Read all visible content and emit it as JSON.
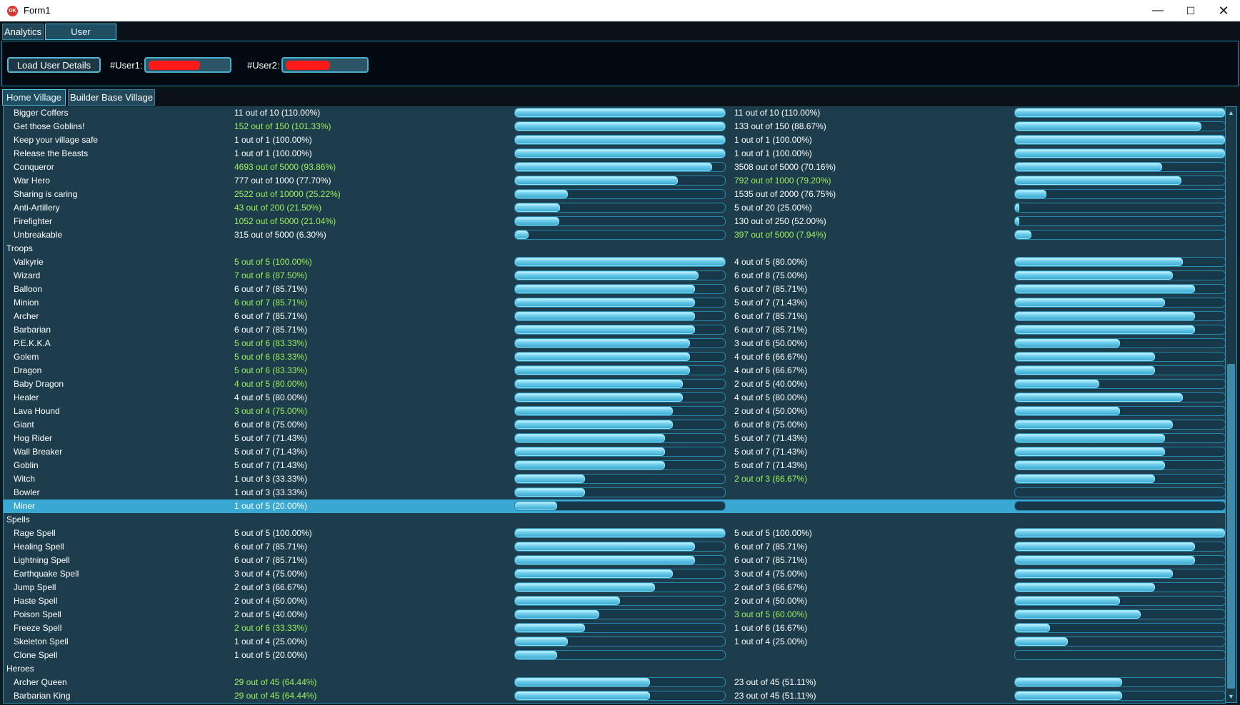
{
  "window": {
    "title": "Form1",
    "app_icon_label": "OK"
  },
  "tabs": [
    {
      "label": "Analytics",
      "active": false
    },
    {
      "label": "User Comparison",
      "active": true
    }
  ],
  "header": {
    "load_button": "Load User Details",
    "user1_label": "#User1:",
    "user2_label": "#User2:"
  },
  "subtabs": [
    {
      "label": "Home Village",
      "active": true
    },
    {
      "label": "Builder Base Village",
      "active": false
    }
  ],
  "colors": {
    "highlight_green": "#9cf05c",
    "selected_row": "#39a9d3",
    "accent": "#4ec8ee"
  },
  "rows": [
    {
      "type": "item",
      "name": "Bigger Coffers",
      "u1": "11 out of 10 (110.00%)",
      "u1_pct": 100,
      "u1_green": false,
      "u2": "11 out of 10 (110.00%)",
      "u2_pct": 100,
      "u2_green": false
    },
    {
      "type": "item",
      "name": "Get those Goblins!",
      "u1": "152 out of 150 (101.33%)",
      "u1_pct": 100,
      "u1_green": true,
      "u2": "133 out of 150 (88.67%)",
      "u2_pct": 88.67,
      "u2_green": false
    },
    {
      "type": "item",
      "name": "Keep your village safe",
      "u1": "1 out of 1 (100.00%)",
      "u1_pct": 100,
      "u1_green": false,
      "u2": "1 out of 1 (100.00%)",
      "u2_pct": 100,
      "u2_green": false
    },
    {
      "type": "item",
      "name": "Release the Beasts",
      "u1": "1 out of 1 (100.00%)",
      "u1_pct": 100,
      "u1_green": false,
      "u2": "1 out of 1 (100.00%)",
      "u2_pct": 100,
      "u2_green": false
    },
    {
      "type": "item",
      "name": "Conqueror",
      "u1": "4693 out of 5000 (93.86%)",
      "u1_pct": 93.86,
      "u1_green": true,
      "u2": "3508 out of 5000 (70.16%)",
      "u2_pct": 70.16,
      "u2_green": false
    },
    {
      "type": "item",
      "name": "War Hero",
      "u1": "777 out of 1000 (77.70%)",
      "u1_pct": 77.7,
      "u1_green": false,
      "u2": "792 out of 1000 (79.20%)",
      "u2_pct": 79.2,
      "u2_green": true
    },
    {
      "type": "item",
      "name": "Sharing is caring",
      "u1": "2522 out of 10000 (25.22%)",
      "u1_pct": 25.22,
      "u1_green": true,
      "u2": "1535 out of 2000 (76.75%)",
      "u2_pct": 15,
      "u2_green": false
    },
    {
      "type": "item",
      "name": "Anti-Artillery",
      "u1": "43 out of 200 (21.50%)",
      "u1_pct": 21.5,
      "u1_green": true,
      "u2": "5 out of 20 (25.00%)",
      "u2_pct": 2,
      "u2_green": false
    },
    {
      "type": "item",
      "name": "Firefighter",
      "u1": "1052 out of 5000 (21.04%)",
      "u1_pct": 21.04,
      "u1_green": true,
      "u2": "130 out of 250 (52.00%)",
      "u2_pct": 2,
      "u2_green": false
    },
    {
      "type": "item",
      "name": "Unbreakable",
      "u1": "315 out of 5000 (6.30%)",
      "u1_pct": 6.3,
      "u1_green": false,
      "u2": "397 out of 5000 (7.94%)",
      "u2_pct": 7.94,
      "u2_green": true
    },
    {
      "type": "group",
      "name": "Troops"
    },
    {
      "type": "item",
      "name": "Valkyrie",
      "u1": "5 out of 5 (100.00%)",
      "u1_pct": 100,
      "u1_green": true,
      "u2": "4 out of 5 (80.00%)",
      "u2_pct": 80,
      "u2_green": false
    },
    {
      "type": "item",
      "name": "Wizard",
      "u1": "7 out of 8 (87.50%)",
      "u1_pct": 87.5,
      "u1_green": true,
      "u2": "6 out of 8 (75.00%)",
      "u2_pct": 75,
      "u2_green": false
    },
    {
      "type": "item",
      "name": "Balloon",
      "u1": "6 out of 7 (85.71%)",
      "u1_pct": 85.71,
      "u1_green": false,
      "u2": "6 out of 7 (85.71%)",
      "u2_pct": 85.71,
      "u2_green": false
    },
    {
      "type": "item",
      "name": "Minion",
      "u1": "6 out of 7 (85.71%)",
      "u1_pct": 85.71,
      "u1_green": true,
      "u2": "5 out of 7 (71.43%)",
      "u2_pct": 71.43,
      "u2_green": false
    },
    {
      "type": "item",
      "name": "Archer",
      "u1": "6 out of 7 (85.71%)",
      "u1_pct": 85.71,
      "u1_green": false,
      "u2": "6 out of 7 (85.71%)",
      "u2_pct": 85.71,
      "u2_green": false
    },
    {
      "type": "item",
      "name": "Barbarian",
      "u1": "6 out of 7 (85.71%)",
      "u1_pct": 85.71,
      "u1_green": false,
      "u2": "6 out of 7 (85.71%)",
      "u2_pct": 85.71,
      "u2_green": false
    },
    {
      "type": "item",
      "name": "P.E.K.K.A",
      "u1": "5 out of 6 (83.33%)",
      "u1_pct": 83.33,
      "u1_green": true,
      "u2": "3 out of 6 (50.00%)",
      "u2_pct": 50,
      "u2_green": false
    },
    {
      "type": "item",
      "name": "Golem",
      "u1": "5 out of 6 (83.33%)",
      "u1_pct": 83.33,
      "u1_green": true,
      "u2": "4 out of 6 (66.67%)",
      "u2_pct": 66.67,
      "u2_green": false
    },
    {
      "type": "item",
      "name": "Dragon",
      "u1": "5 out of 6 (83.33%)",
      "u1_pct": 83.33,
      "u1_green": true,
      "u2": "4 out of 6 (66.67%)",
      "u2_pct": 66.67,
      "u2_green": false
    },
    {
      "type": "item",
      "name": "Baby Dragon",
      "u1": "4 out of 5 (80.00%)",
      "u1_pct": 80,
      "u1_green": true,
      "u2": "2 out of 5 (40.00%)",
      "u2_pct": 40,
      "u2_green": false
    },
    {
      "type": "item",
      "name": "Healer",
      "u1": "4 out of 5 (80.00%)",
      "u1_pct": 80,
      "u1_green": false,
      "u2": "4 out of 5 (80.00%)",
      "u2_pct": 80,
      "u2_green": false
    },
    {
      "type": "item",
      "name": "Lava Hound",
      "u1": "3 out of 4 (75.00%)",
      "u1_pct": 75,
      "u1_green": true,
      "u2": "2 out of 4 (50.00%)",
      "u2_pct": 50,
      "u2_green": false
    },
    {
      "type": "item",
      "name": "Giant",
      "u1": "6 out of 8 (75.00%)",
      "u1_pct": 75,
      "u1_green": false,
      "u2": "6 out of 8 (75.00%)",
      "u2_pct": 75,
      "u2_green": false
    },
    {
      "type": "item",
      "name": "Hog Rider",
      "u1": "5 out of 7 (71.43%)",
      "u1_pct": 71.43,
      "u1_green": false,
      "u2": "5 out of 7 (71.43%)",
      "u2_pct": 71.43,
      "u2_green": false
    },
    {
      "type": "item",
      "name": "Wall Breaker",
      "u1": "5 out of 7 (71.43%)",
      "u1_pct": 71.43,
      "u1_green": false,
      "u2": "5 out of 7 (71.43%)",
      "u2_pct": 71.43,
      "u2_green": false
    },
    {
      "type": "item",
      "name": "Goblin",
      "u1": "5 out of 7 (71.43%)",
      "u1_pct": 71.43,
      "u1_green": false,
      "u2": "5 out of 7 (71.43%)",
      "u2_pct": 71.43,
      "u2_green": false
    },
    {
      "type": "item",
      "name": "Witch",
      "u1": "1 out of 3 (33.33%)",
      "u1_pct": 33.33,
      "u1_green": false,
      "u2": "2 out of 3 (66.67%)",
      "u2_pct": 66.67,
      "u2_green": true
    },
    {
      "type": "item",
      "name": "Bowler",
      "u1": "1 out of 3 (33.33%)",
      "u1_pct": 33.33,
      "u1_green": false,
      "u2": "",
      "u2_pct": 0,
      "u2_green": false
    },
    {
      "type": "item",
      "name": "Miner",
      "u1": "1 out of 5 (20.00%)",
      "u1_pct": 20,
      "u1_green": false,
      "u2": "",
      "u2_pct": 0,
      "u2_green": false,
      "selected": true
    },
    {
      "type": "group",
      "name": "Spells"
    },
    {
      "type": "item",
      "name": "Rage Spell",
      "u1": "5 out of 5 (100.00%)",
      "u1_pct": 100,
      "u1_green": false,
      "u2": "5 out of 5 (100.00%)",
      "u2_pct": 100,
      "u2_green": false
    },
    {
      "type": "item",
      "name": "Healing Spell",
      "u1": "6 out of 7 (85.71%)",
      "u1_pct": 85.71,
      "u1_green": false,
      "u2": "6 out of 7 (85.71%)",
      "u2_pct": 85.71,
      "u2_green": false
    },
    {
      "type": "item",
      "name": "Lightning Spell",
      "u1": "6 out of 7 (85.71%)",
      "u1_pct": 85.71,
      "u1_green": false,
      "u2": "6 out of 7 (85.71%)",
      "u2_pct": 85.71,
      "u2_green": false
    },
    {
      "type": "item",
      "name": "Earthquake Spell",
      "u1": "3 out of 4 (75.00%)",
      "u1_pct": 75,
      "u1_green": false,
      "u2": "3 out of 4 (75.00%)",
      "u2_pct": 75,
      "u2_green": false
    },
    {
      "type": "item",
      "name": "Jump Spell",
      "u1": "2 out of 3 (66.67%)",
      "u1_pct": 66.67,
      "u1_green": false,
      "u2": "2 out of 3 (66.67%)",
      "u2_pct": 66.67,
      "u2_green": false
    },
    {
      "type": "item",
      "name": "Haste Spell",
      "u1": "2 out of 4 (50.00%)",
      "u1_pct": 50,
      "u1_green": false,
      "u2": "2 out of 4 (50.00%)",
      "u2_pct": 50,
      "u2_green": false
    },
    {
      "type": "item",
      "name": "Poison Spell",
      "u1": "2 out of 5 (40.00%)",
      "u1_pct": 40,
      "u1_green": false,
      "u2": "3 out of 5 (60.00%)",
      "u2_pct": 60,
      "u2_green": true
    },
    {
      "type": "item",
      "name": "Freeze Spell",
      "u1": "2 out of 6 (33.33%)",
      "u1_pct": 33.33,
      "u1_green": true,
      "u2": "1 out of 6 (16.67%)",
      "u2_pct": 16.67,
      "u2_green": false
    },
    {
      "type": "item",
      "name": "Skeleton Spell",
      "u1": "1 out of 4 (25.00%)",
      "u1_pct": 25,
      "u1_green": false,
      "u2": "1 out of 4 (25.00%)",
      "u2_pct": 25,
      "u2_green": false
    },
    {
      "type": "item",
      "name": "Clone Spell",
      "u1": "1 out of 5 (20.00%)",
      "u1_pct": 20,
      "u1_green": false,
      "u2": "",
      "u2_pct": 0,
      "u2_green": false
    },
    {
      "type": "group",
      "name": "Heroes"
    },
    {
      "type": "item",
      "name": "Archer Queen",
      "u1": "29 out of 45 (64.44%)",
      "u1_pct": 64.44,
      "u1_green": true,
      "u2": "23 out of 45 (51.11%)",
      "u2_pct": 51.11,
      "u2_green": false
    },
    {
      "type": "item",
      "name": "Barbarian King",
      "u1": "29 out of 45 (64.44%)",
      "u1_pct": 64.44,
      "u1_green": true,
      "u2": "23 out of 45 (51.11%)",
      "u2_pct": 51.11,
      "u2_green": false
    }
  ]
}
